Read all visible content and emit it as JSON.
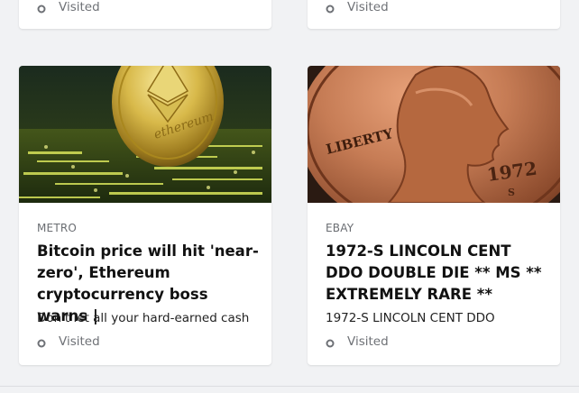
{
  "feed": {
    "top_cards": [
      {
        "visited_label": "Visited"
      },
      {
        "visited_label": "Visited"
      }
    ],
    "cards": [
      {
        "source": "METRO",
        "title": "Bitcoin price will hit 'near-zero', Ethereum cryptocurrency boss warns |",
        "description": "Don't let all your hard-earned cash",
        "visited_label": "Visited",
        "image": "ethereum-coin-on-circuit-board"
      },
      {
        "source": "EBAY",
        "title": "1972-S LINCOLN CENT DDO DOUBLE DIE ** MS ** EXTREMELY RARE **",
        "description": "1972-S LINCOLN CENT DDO",
        "visited_label": "Visited",
        "image": "lincoln-penny-closeup"
      }
    ]
  },
  "colors": {
    "page_background": "#f1f2f4",
    "card_background": "#ffffff",
    "source_text": "#6a6d72",
    "title_text": "#111111",
    "visited_text": "#6e7176"
  }
}
